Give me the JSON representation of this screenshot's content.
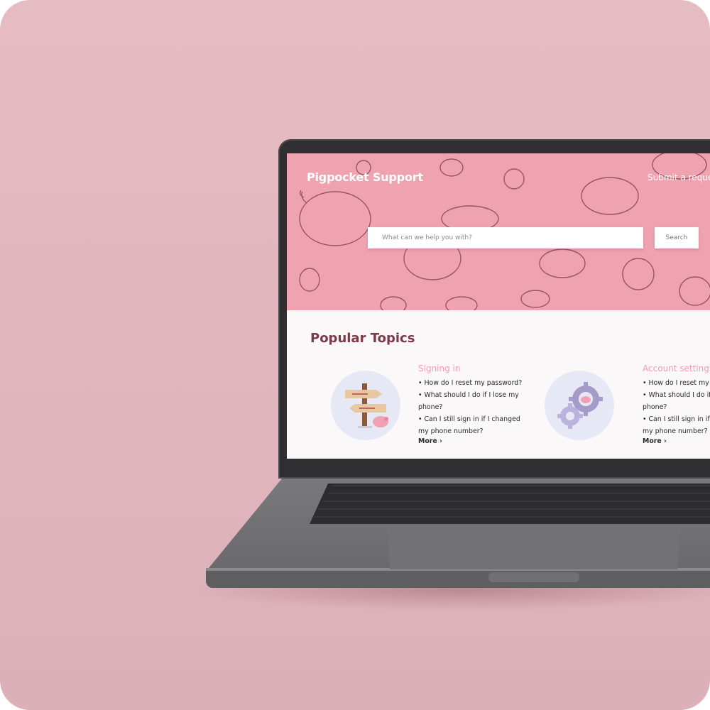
{
  "header": {
    "brand": "Pigpocket Support",
    "submit_link": "Submit a reque"
  },
  "search": {
    "placeholder": "What can we help you with?",
    "button_label": "Search"
  },
  "popular": {
    "title": "Popular Topics",
    "topics": [
      {
        "heading": "Signing in",
        "icon": "signpost-icon",
        "items": [
          "• How do I reset my password?",
          "• What should I do if I lose my phone?",
          "• Can I still sign in if I changed my phone number?"
        ],
        "more": "More ›"
      },
      {
        "heading": "Account settings",
        "icon": "gears-icon",
        "items": [
          "• How do I reset my pa",
          "• What should I do if I l phone?",
          "• Can I still sign in if I c my phone number?"
        ],
        "more": "More ›"
      }
    ]
  },
  "colors": {
    "background": "#e3b8bf",
    "hero": "#efa3b0",
    "title": "#7b3a48",
    "topic_heading": "#ef9db0",
    "laptop": "#2f2f31"
  }
}
